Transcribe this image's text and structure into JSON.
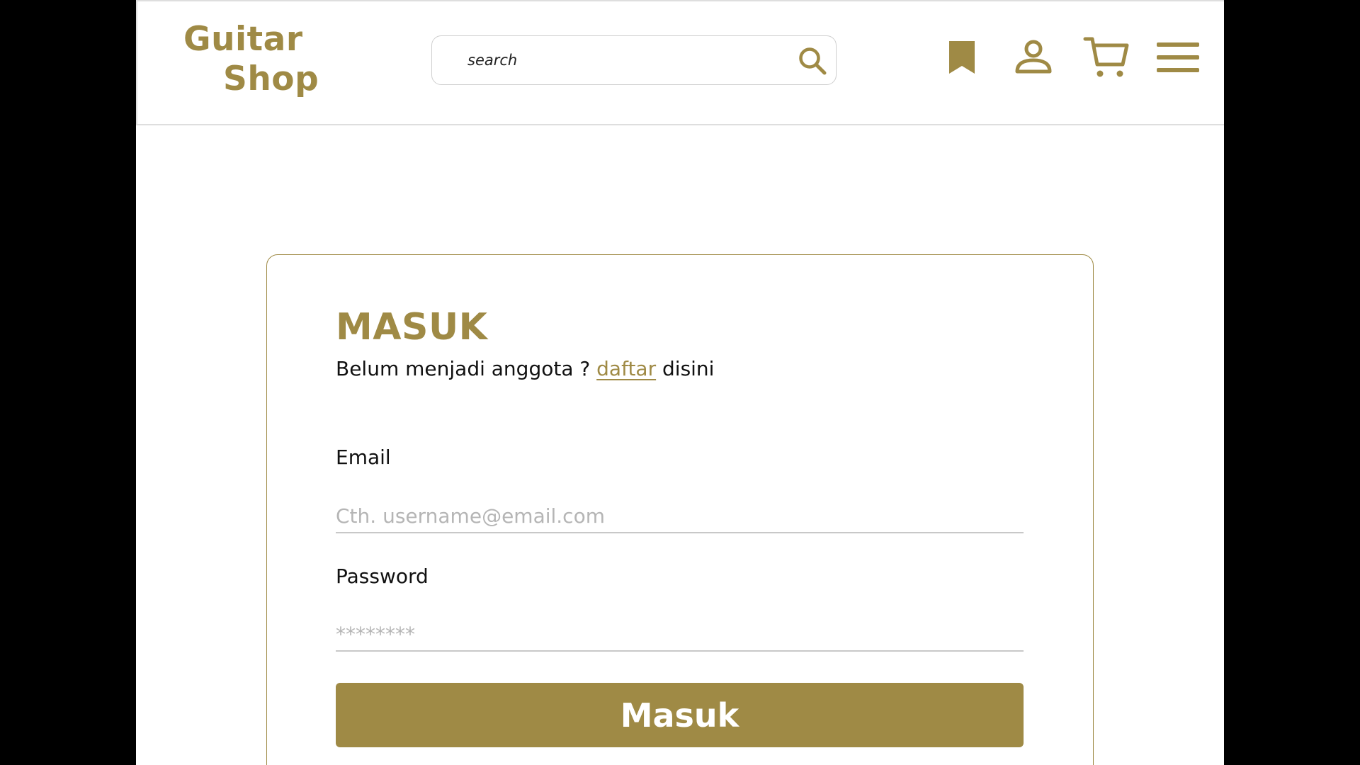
{
  "brand": {
    "line1": "Guitar",
    "line2": "Shop"
  },
  "search": {
    "placeholder": "search",
    "icon": "search-icon"
  },
  "nav_icons": [
    "bookmark-icon",
    "user-icon",
    "cart-icon",
    "menu-icon"
  ],
  "login": {
    "title": "MASUK",
    "subtitle_prefix": "Belum menjadi anggota ? ",
    "register_link": "daftar",
    "subtitle_suffix": " disini",
    "email_label": "Email",
    "email_placeholder": "Cth. username@email.com",
    "password_label": "Password",
    "password_placeholder": "********",
    "submit_label": "Masuk"
  },
  "colors": {
    "accent": "#9f8a45",
    "page_background": "#ffffff",
    "outer_background": "#000000"
  }
}
